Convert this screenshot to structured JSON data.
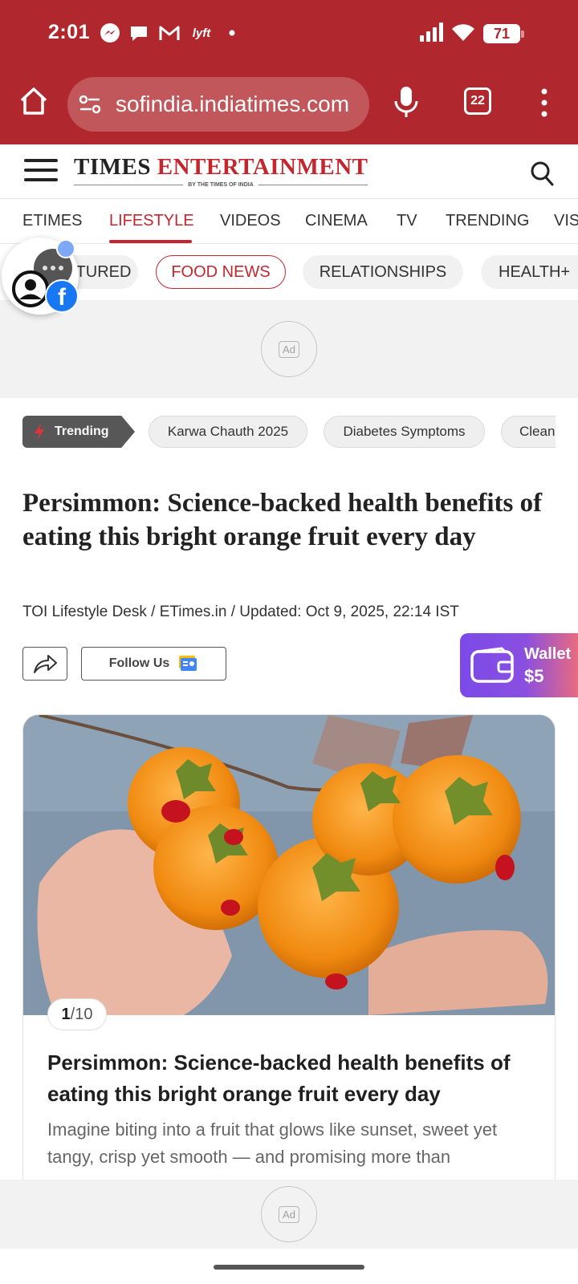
{
  "status_bar": {
    "time": "2:01",
    "battery": "71",
    "notification_icons": [
      "messenger-icon",
      "chat-icon",
      "gmail-icon",
      "lyft-icon",
      "more-dot-icon"
    ],
    "lyft_label": "lyft",
    "right_icons": [
      "signal-icon",
      "wifi-icon",
      "battery-icon"
    ]
  },
  "browser": {
    "url": "sofindia.indiatimes.com",
    "tab_count": "22",
    "accent_color": "#b0282e"
  },
  "site": {
    "logo_main": "TIMES",
    "logo_accent": "ENTERTAINMENT",
    "logo_tagline": "BY THE TIMES OF INDIA"
  },
  "nav": {
    "items": [
      "ETIMES",
      "LIFESTYLE",
      "VIDEOS",
      "CINEMA",
      "TV",
      "TRENDING",
      "VIS"
    ],
    "active": "LIFESTYLE"
  },
  "subnav": {
    "items": [
      "TURED",
      "FOOD NEWS",
      "RELATIONSHIPS",
      "HEALTH+"
    ],
    "active": "FOOD NEWS"
  },
  "ads": {
    "label": "Ad"
  },
  "trending": {
    "label": "Trending",
    "chips": [
      "Karwa Chauth 2025",
      "Diabetes Symptoms",
      "Clean"
    ]
  },
  "article": {
    "headline": "Persimmon: Science-backed health benefits of eating this bright orange fruit every day",
    "byline": "TOI Lifestyle Desk / ETimes.in / Updated: Oct 9, 2025, 22:14 IST",
    "follow_label": "Follow Us"
  },
  "wallet": {
    "label": "Wallet",
    "amount": "$5"
  },
  "card": {
    "counter_current": "1",
    "counter_total": "/10",
    "title": "Persimmon: Science-backed health benefits of eating this bright orange fruit every day",
    "description": "Imagine biting into a fruit that glows like sunset, sweet yet tangy, crisp yet smooth — and promising more than"
  }
}
